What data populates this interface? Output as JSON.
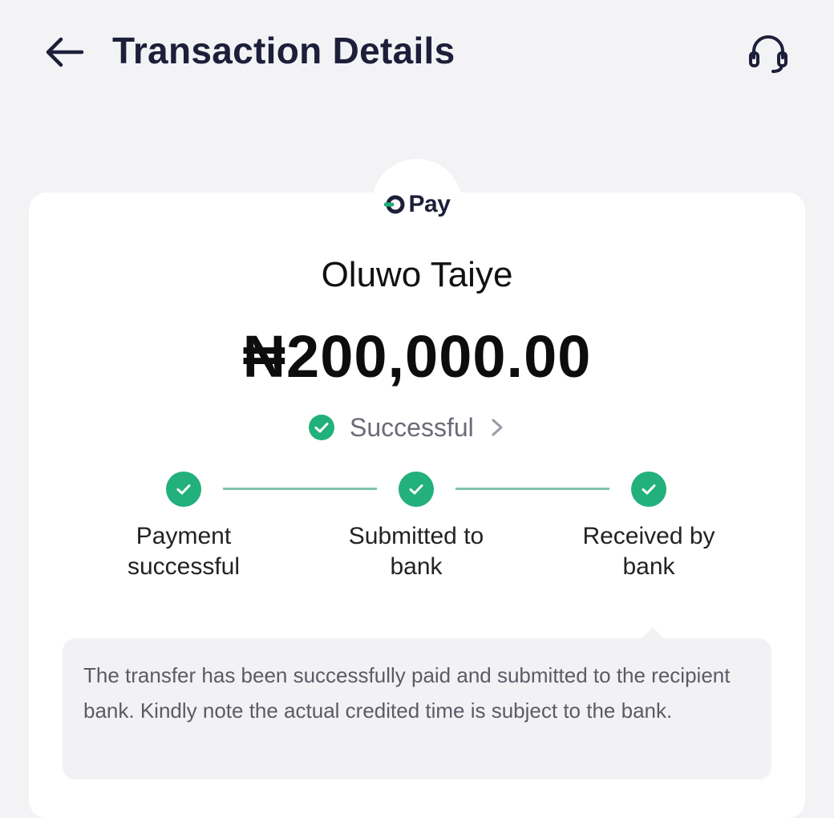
{
  "header": {
    "title": "Transaction Details",
    "back_icon": "arrow-left-icon",
    "support_icon": "headset-icon"
  },
  "brand": {
    "name": "Pay",
    "brand_color": "#22b07d"
  },
  "transaction": {
    "recipient": "Oluwo Taiye",
    "amount": "₦200,000.00",
    "status": "Successful",
    "status_color": "#22b07d"
  },
  "steps": [
    {
      "label_line1": "Payment",
      "label_line2": "successful",
      "done": true
    },
    {
      "label_line1": "Submitted to",
      "label_line2": "bank",
      "done": true
    },
    {
      "label_line1": "Received by",
      "label_line2": "bank",
      "done": true
    }
  ],
  "note": {
    "text": "The transfer has been successfully paid and submitted to the recipient bank. Kindly note the actual credited time is subject to the bank."
  }
}
